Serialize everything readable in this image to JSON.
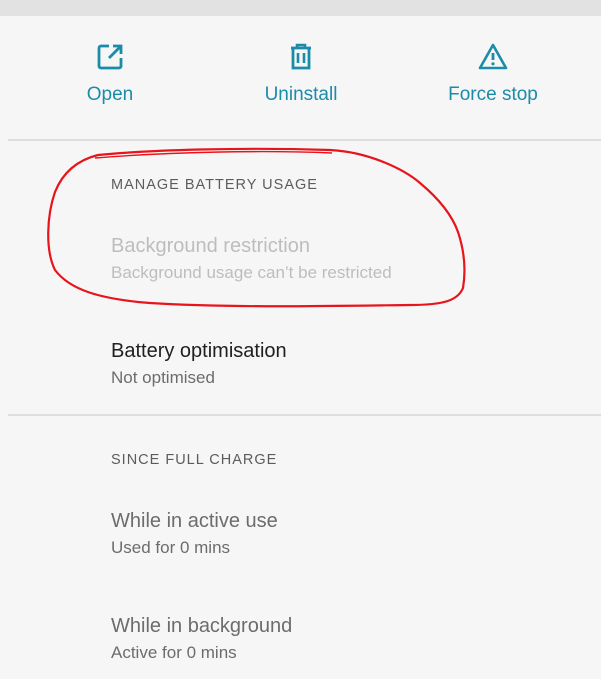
{
  "actions": [
    {
      "label": "Open",
      "icon": "open-in-new-icon"
    },
    {
      "label": "Uninstall",
      "icon": "trash-icon"
    },
    {
      "label": "Force stop",
      "icon": "warning-icon"
    }
  ],
  "battery_section": {
    "header": "MANAGE BATTERY USAGE",
    "background_restriction": {
      "title": "Background restriction",
      "summary": "Background usage can’t be restricted"
    },
    "battery_optimisation": {
      "title": "Battery optimisation",
      "summary": "Not optimised"
    }
  },
  "usage_section": {
    "header": "SINCE FULL CHARGE",
    "active_use": {
      "title": "While in active use",
      "summary": "Used for 0 mins"
    },
    "background": {
      "title": "While in background",
      "summary": "Active for 0 mins"
    }
  },
  "colors": {
    "accent": "#1a8ca8",
    "annotation": "#e8141c",
    "background": "#f6f6f6"
  }
}
